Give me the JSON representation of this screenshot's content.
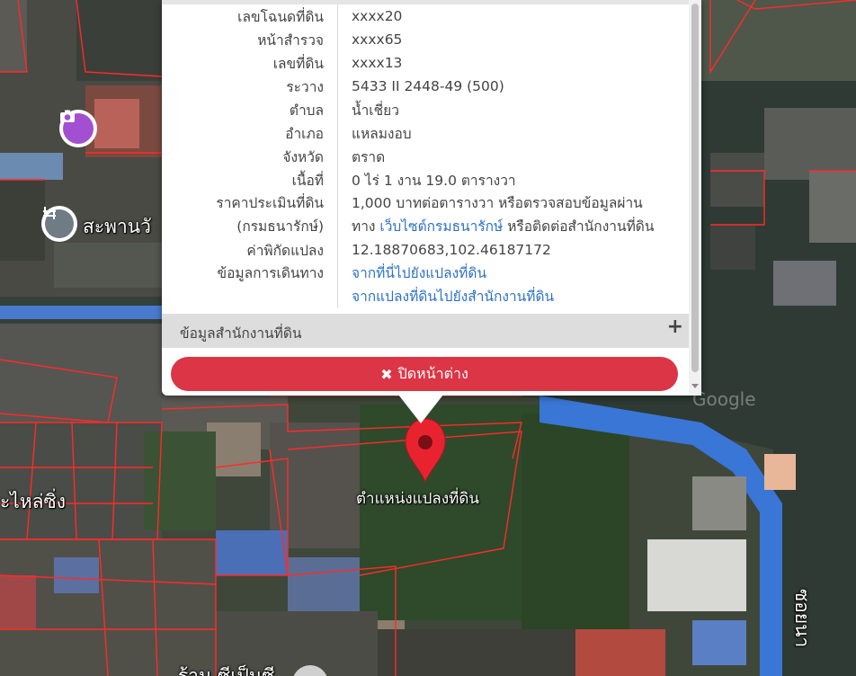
{
  "map": {
    "marker_label": "ตำแหน่งแปลงที่ดิน",
    "place_labels": [
      "สะพานวั",
      "ะไหล่ซิ่ง",
      "ร้าน ซีเป็นซี",
      "ซอยนา"
    ],
    "google_watermark": "Google"
  },
  "popup": {
    "rows": [
      {
        "label": "เลขโฉนดที่ดิน",
        "value": "xxxx20"
      },
      {
        "label": "หน้าสำรวจ",
        "value": "xxxx65"
      },
      {
        "label": "เลขที่ดิน",
        "value": "xxxx13"
      },
      {
        "label": "ระวาง",
        "value": "5433 II 2448-49 (500)"
      },
      {
        "label": "ตำบล",
        "value": "น้ำเชี่ยว"
      },
      {
        "label": "อำเภอ",
        "value": "แหลมงอบ"
      },
      {
        "label": "จังหวัด",
        "value": "ตราด"
      },
      {
        "label": "เนื้อที่",
        "value": "0 ไร่ 1 งาน 19.0 ตารางวา"
      }
    ],
    "price": {
      "label_line1": "ราคาประเมินที่ดิน",
      "label_line2": "(กรมธนารักษ์)",
      "value_line1": "1,000 บาทต่อตารางวา หรือตรวจสอบข้อมูลผ่าน",
      "value_pre_link": "ทาง ",
      "value_link": "เว็บไซต์กรมธนารักษ์",
      "value_post_link": " หรือติดต่อสำนักงานที่ดิน"
    },
    "coord": {
      "label": "ค่าพิกัดแปลง",
      "value": "12.18870683,102.46187172"
    },
    "travel": {
      "label": "ข้อมูลการเดินทาง",
      "link1": "จากที่นี่ไปยังแปลงที่ดิน",
      "link2": "จากแปลงที่ดินไปยังสำนักงานที่ดิน"
    },
    "office_section": {
      "label": "ข้อมูลสำนักงานที่ดิน",
      "expand_icon": "+"
    },
    "close_button": {
      "icon": "✖",
      "label": "ปิดหน้าต่าง"
    }
  },
  "colors": {
    "close_button": "#dc3545",
    "link": "#2f72c4",
    "marker": "#e8232f",
    "parcel_lines": "#ff2a2a",
    "water": "#2f3a33"
  }
}
